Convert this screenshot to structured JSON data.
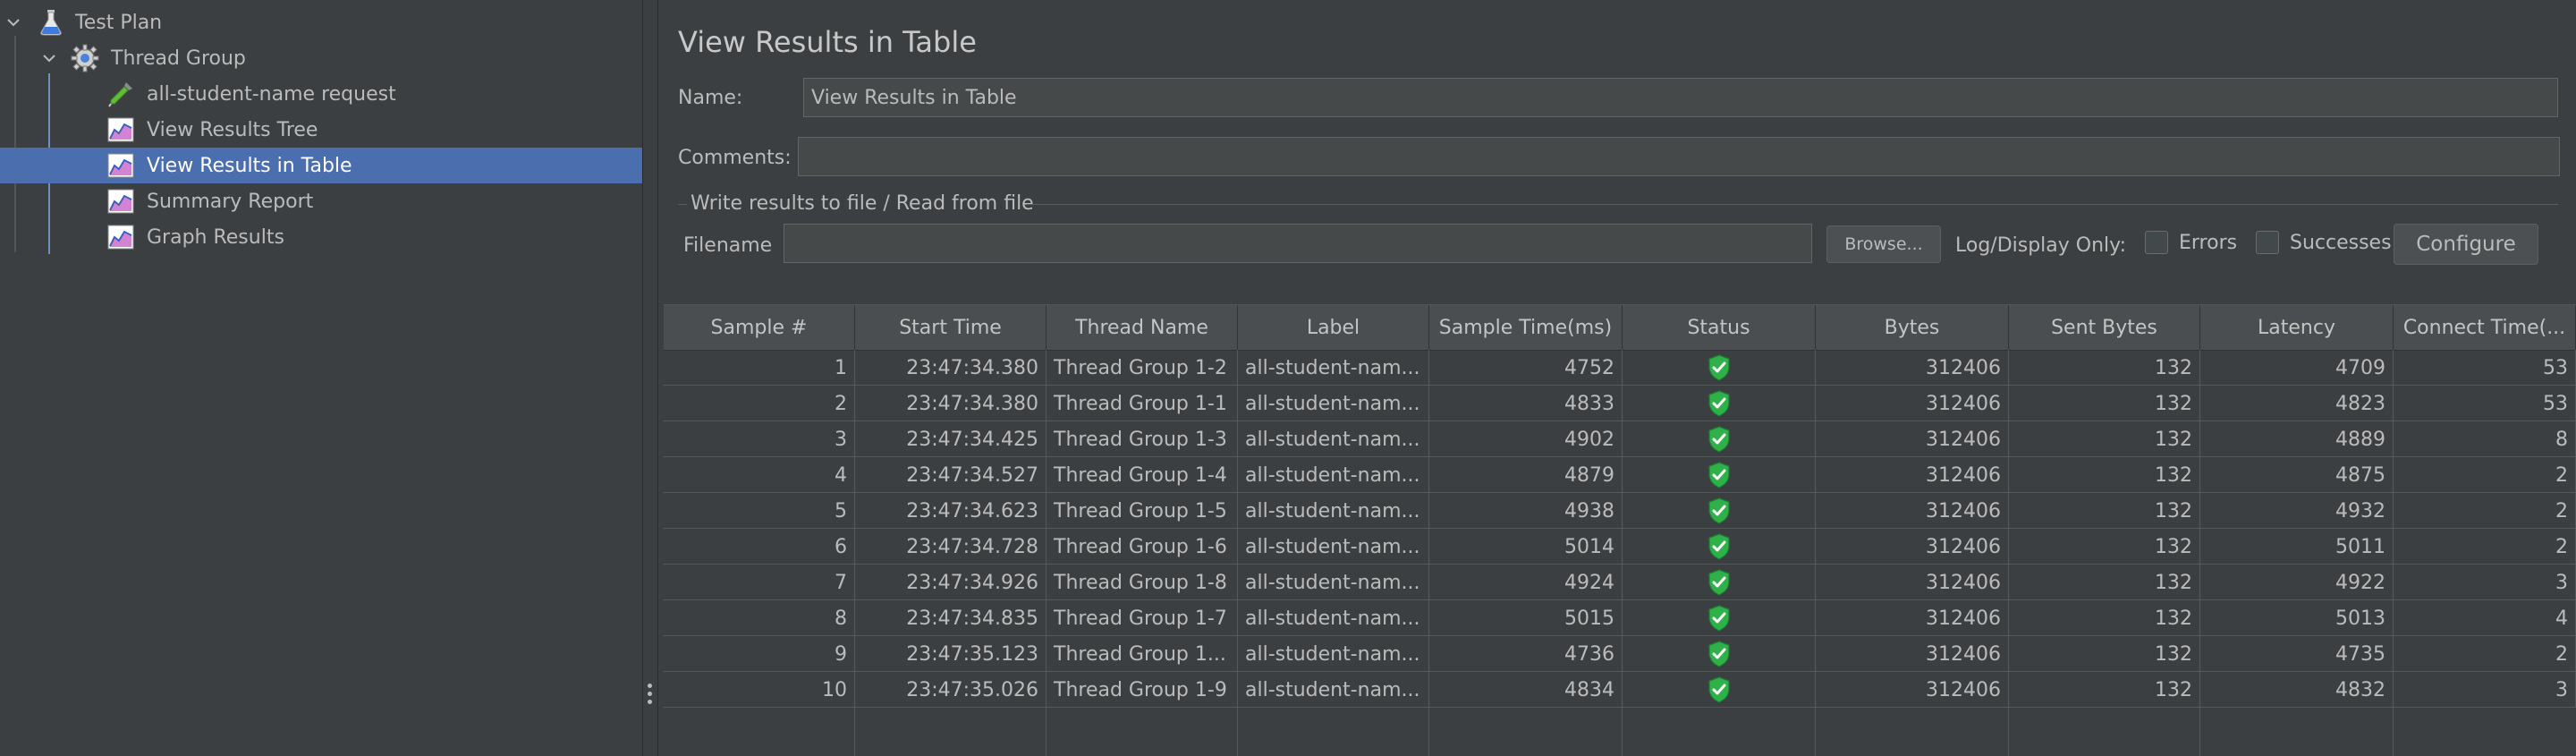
{
  "tree": {
    "items": [
      {
        "label": "Test Plan",
        "icon": "flask-icon"
      },
      {
        "label": "Thread Group",
        "icon": "gear-icon"
      },
      {
        "label": "all-student-name request",
        "icon": "pipette-icon"
      },
      {
        "label": "View Results Tree",
        "icon": "chart-icon"
      },
      {
        "label": "View Results in Table",
        "icon": "chart-icon"
      },
      {
        "label": "Summary Report",
        "icon": "chart-icon"
      },
      {
        "label": "Graph Results",
        "icon": "chart-icon"
      }
    ],
    "selected_index": 4
  },
  "panel": {
    "title": "View Results in Table",
    "name_label": "Name:",
    "name_value": "View Results in Table",
    "comments_label": "Comments:",
    "comments_value": "",
    "file_section_title": "Write results to file / Read from file",
    "filename_label": "Filename",
    "filename_value": "",
    "browse_label": "Browse...",
    "log_display_label": "Log/Display Only:",
    "errors_label": "Errors",
    "successes_label": "Successes",
    "configure_label": "Configure"
  },
  "table": {
    "columns": [
      "Sample #",
      "Start Time",
      "Thread Name",
      "Label",
      "Sample Time(ms)",
      "Status",
      "Bytes",
      "Sent Bytes",
      "Latency",
      "Connect Time(..."
    ],
    "rows": [
      [
        "1",
        "23:47:34.380",
        "Thread Group 1-2",
        "all-student-nam...",
        "4752",
        "success",
        "312406",
        "132",
        "4709",
        "53"
      ],
      [
        "2",
        "23:47:34.380",
        "Thread Group 1-1",
        "all-student-nam...",
        "4833",
        "success",
        "312406",
        "132",
        "4823",
        "53"
      ],
      [
        "3",
        "23:47:34.425",
        "Thread Group 1-3",
        "all-student-nam...",
        "4902",
        "success",
        "312406",
        "132",
        "4889",
        "8"
      ],
      [
        "4",
        "23:47:34.527",
        "Thread Group 1-4",
        "all-student-nam...",
        "4879",
        "success",
        "312406",
        "132",
        "4875",
        "2"
      ],
      [
        "5",
        "23:47:34.623",
        "Thread Group 1-5",
        "all-student-nam...",
        "4938",
        "success",
        "312406",
        "132",
        "4932",
        "2"
      ],
      [
        "6",
        "23:47:34.728",
        "Thread Group 1-6",
        "all-student-nam...",
        "5014",
        "success",
        "312406",
        "132",
        "5011",
        "2"
      ],
      [
        "7",
        "23:47:34.926",
        "Thread Group 1-8",
        "all-student-nam...",
        "4924",
        "success",
        "312406",
        "132",
        "4922",
        "3"
      ],
      [
        "8",
        "23:47:34.835",
        "Thread Group 1-7",
        "all-student-nam...",
        "5015",
        "success",
        "312406",
        "132",
        "5013",
        "4"
      ],
      [
        "9",
        "23:47:35.123",
        "Thread Group 1...",
        "all-student-nam...",
        "4736",
        "success",
        "312406",
        "132",
        "4735",
        "2"
      ],
      [
        "10",
        "23:47:35.026",
        "Thread Group 1-9",
        "all-student-nam...",
        "4834",
        "success",
        "312406",
        "132",
        "4832",
        "3"
      ]
    ]
  },
  "colors": {
    "background": "#3c3f41",
    "selection": "#4b6eaf",
    "status_success": "#2fb14a"
  }
}
